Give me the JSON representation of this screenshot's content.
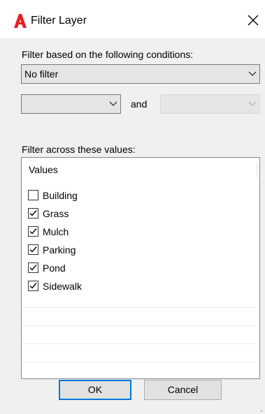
{
  "window": {
    "title": "Filter Layer",
    "close_glyph": "✕",
    "app_icon": "autocad-logo-icon"
  },
  "conditions": {
    "label": "Filter based on the following conditions:",
    "filter_select": {
      "selected": "No filter"
    },
    "left_select": {
      "selected": "",
      "enabled": true
    },
    "connector": "and",
    "right_select": {
      "selected": "",
      "enabled": false
    }
  },
  "values_section": {
    "label": "Filter across these values:",
    "column_header": "Values",
    "items": [
      {
        "label": "Building",
        "checked": false
      },
      {
        "label": "Grass",
        "checked": true
      },
      {
        "label": "Mulch",
        "checked": true
      },
      {
        "label": "Parking",
        "checked": true
      },
      {
        "label": "Pond",
        "checked": true
      },
      {
        "label": "Sidewalk",
        "checked": true
      }
    ]
  },
  "buttons": {
    "ok": "OK",
    "cancel": "Cancel"
  },
  "colors": {
    "dialog_bg": "#f0f0f0",
    "titlebar_bg": "#ffffff",
    "accent": "#0078d7",
    "icon_red": "#e51f24"
  }
}
